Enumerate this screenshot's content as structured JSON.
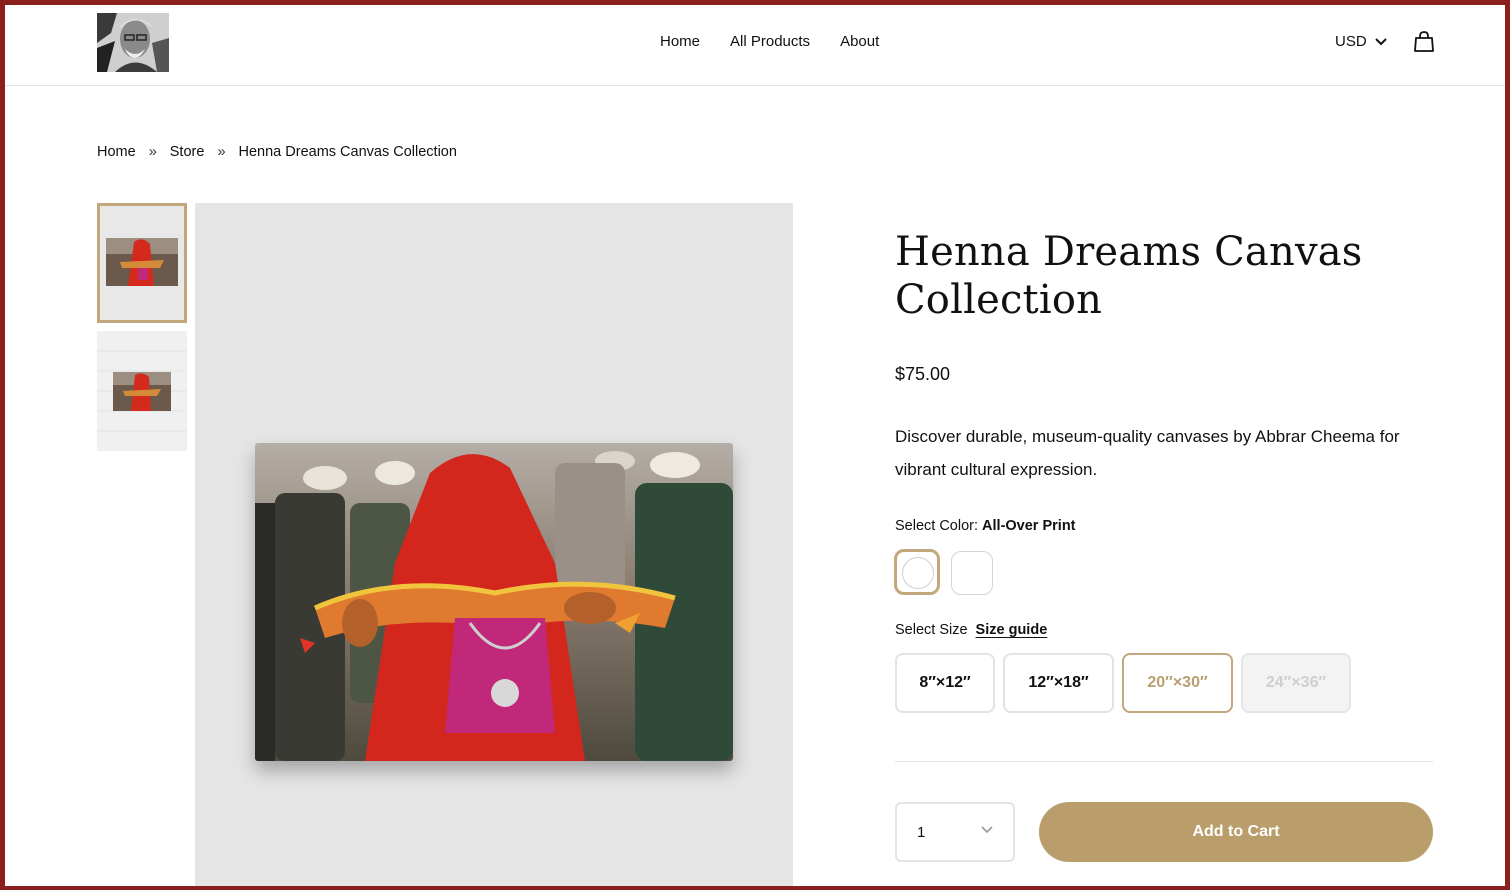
{
  "header": {
    "nav": [
      "Home",
      "All Products",
      "About"
    ],
    "currency": "USD",
    "icons": {
      "logo": "portrait-logo",
      "currency_chevron": "chevron-down-icon",
      "cart": "shopping-bag-icon"
    }
  },
  "breadcrumb": {
    "items": [
      "Home",
      "Store",
      "Henna Dreams Canvas Collection"
    ],
    "separator": "»"
  },
  "product": {
    "title": "Henna Dreams Canvas Collection",
    "price": "$75.00",
    "description": "Discover durable, museum-quality canvases by Abbrar Cheema for vibrant cultural expression.",
    "color_label": "Select Color:",
    "color_value": "All-Over Print",
    "size_label": "Select Size",
    "size_guide": "Size guide",
    "sizes": [
      {
        "label": "8″×12″",
        "state": "default"
      },
      {
        "label": "12″×18″",
        "state": "default"
      },
      {
        "label": "20″×30″",
        "state": "selected"
      },
      {
        "label": "24″×36″",
        "state": "disabled"
      }
    ],
    "quantity": "1",
    "add_to_cart": "Add to Cart"
  },
  "colors": {
    "frame": "#8b1f1b",
    "accent": "#b99e6c",
    "accent_border": "#c2a77c"
  }
}
